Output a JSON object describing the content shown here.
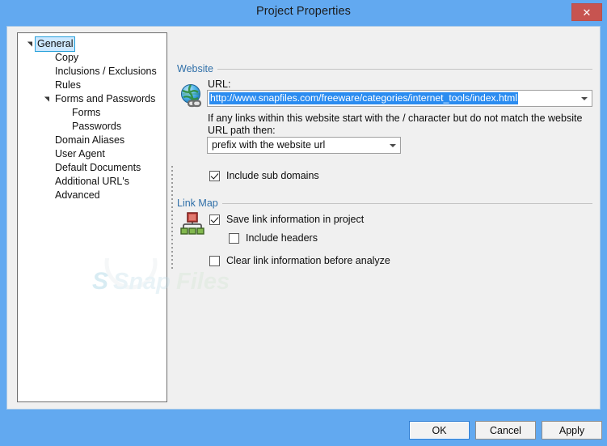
{
  "window": {
    "title": "Project Properties",
    "close_label": "✕",
    "close_icon": "close-icon",
    "titlebar_color": "#62a9f0",
    "close_button_color": "#c75450"
  },
  "tree": {
    "items": [
      {
        "label": "General",
        "indent": 0,
        "expander": "expanded",
        "selected": true
      },
      {
        "label": "Copy",
        "indent": 1,
        "expander": "none",
        "selected": false
      },
      {
        "label": "Inclusions / Exclusions",
        "indent": 1,
        "expander": "none",
        "selected": false
      },
      {
        "label": "Rules",
        "indent": 1,
        "expander": "none",
        "selected": false
      },
      {
        "label": "Forms and Passwords",
        "indent": 1,
        "expander": "expanded",
        "selected": false
      },
      {
        "label": "Forms",
        "indent": 2,
        "expander": "none",
        "selected": false
      },
      {
        "label": "Passwords",
        "indent": 2,
        "expander": "none",
        "selected": false
      },
      {
        "label": "Domain Aliases",
        "indent": 1,
        "expander": "none",
        "selected": false
      },
      {
        "label": "User Agent",
        "indent": 1,
        "expander": "none",
        "selected": false
      },
      {
        "label": "Default Documents",
        "indent": 1,
        "expander": "none",
        "selected": false
      },
      {
        "label": "Additional URL's",
        "indent": 1,
        "expander": "none",
        "selected": false
      },
      {
        "label": "Advanced",
        "indent": 1,
        "expander": "none",
        "selected": false
      }
    ]
  },
  "website": {
    "group_label": "Website",
    "icon": "globe-link-icon",
    "url_label": "URL:",
    "url_value": "http://www.snapfiles.com/freeware/categories/internet_tools/index.html",
    "url_selected": true,
    "selection_color": "#2b8cf0",
    "hint": "If any links within this website start with the / character but do not match the website URL path then:",
    "prefix_value": "prefix with the website url",
    "prefix_options": [
      "prefix with the website url"
    ],
    "include_sub_domains": {
      "label": "Include sub domains",
      "checked": true
    }
  },
  "link_map": {
    "group_label": "Link Map",
    "icon": "sitemap-icon",
    "save_link_info": {
      "label": "Save link information in project",
      "checked": true
    },
    "include_headers": {
      "label": "Include headers",
      "checked": false
    },
    "clear_link_info": {
      "label": "Clear link information before analyze",
      "checked": false
    }
  },
  "watermark": {
    "text": "SnapFiles"
  },
  "footer": {
    "ok_label": "OK",
    "cancel_label": "Cancel",
    "apply_label": "Apply"
  }
}
